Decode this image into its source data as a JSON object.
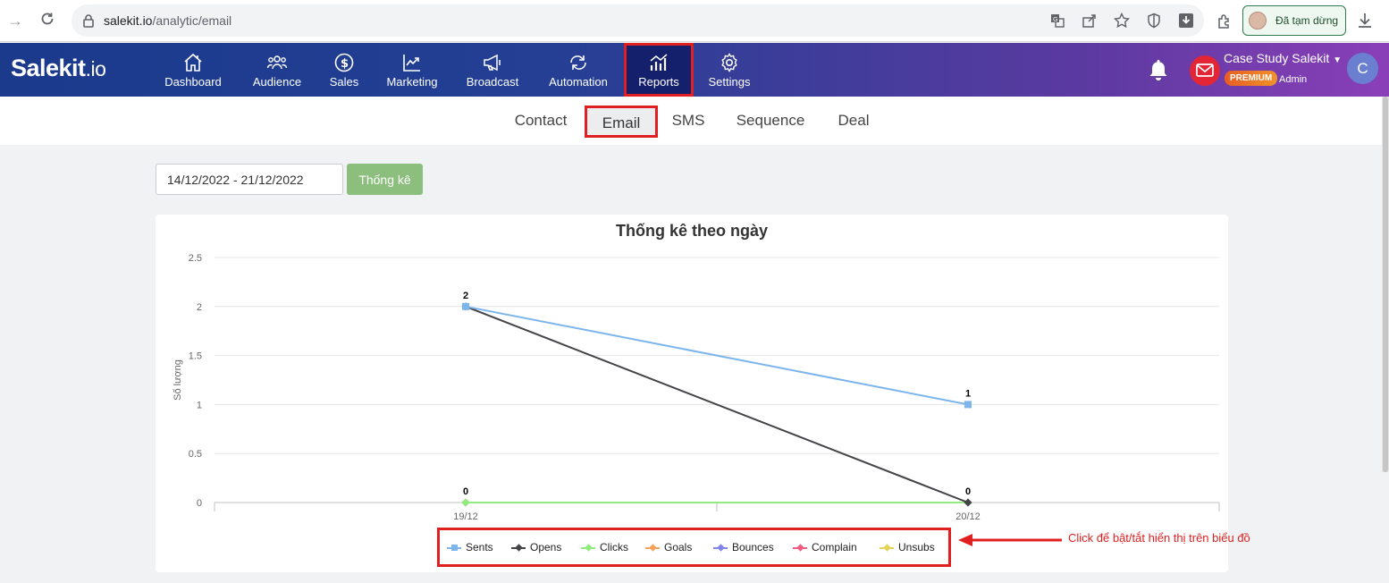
{
  "browser": {
    "url_host": "salekit.io",
    "url_path": "/analytic/email",
    "paused_label": "Đã tạm dừng"
  },
  "app": {
    "logo_main": "Salekit",
    "logo_suffix": ".io",
    "nav": [
      {
        "label": "Dashboard",
        "icon": "home-icon"
      },
      {
        "label": "Audience",
        "icon": "users-icon"
      },
      {
        "label": "Sales",
        "icon": "dollar-icon"
      },
      {
        "label": "Marketing",
        "icon": "trend-icon"
      },
      {
        "label": "Broadcast",
        "icon": "megaphone-icon"
      },
      {
        "label": "Automation",
        "icon": "cycle-icon"
      },
      {
        "label": "Reports",
        "icon": "bar-chart-icon"
      },
      {
        "label": "Settings",
        "icon": "gear-icon"
      }
    ],
    "active_nav": "Reports",
    "account_name": "Case Study Salekit",
    "badge": "PREMIUM",
    "role": "Admin",
    "avatar_letter": "C"
  },
  "tabs": [
    {
      "label": "Contact"
    },
    {
      "label": "Email"
    },
    {
      "label": "SMS"
    },
    {
      "label": "Sequence"
    },
    {
      "label": "Deal"
    }
  ],
  "active_tab": "Email",
  "filter": {
    "date_range": "14/12/2022 - 21/12/2022",
    "button_label": "Thống kê"
  },
  "annotation": "Click để bật/tắt hiển thị trên biểu đồ",
  "chart_data": {
    "type": "line",
    "title": "Thống kê theo ngày",
    "ylabel": "Số lượng",
    "xlabel": "",
    "categories": [
      "19/12",
      "20/12"
    ],
    "ylim": [
      0,
      2.5
    ],
    "yticks": [
      "0",
      "0.5",
      "1",
      "1.5",
      "2",
      "2.5"
    ],
    "grid": true,
    "legend_position": "bottom",
    "series": [
      {
        "name": "Sents",
        "values": [
          2,
          1
        ],
        "color": "#7cb5ec",
        "marker": "square"
      },
      {
        "name": "Opens",
        "values": [
          2,
          0
        ],
        "color": "#434348",
        "marker": "diamond"
      },
      {
        "name": "Clicks",
        "values": [
          0,
          0
        ],
        "color": "#90ed7d",
        "marker": "diamond"
      },
      {
        "name": "Goals",
        "values": [
          0,
          0
        ],
        "color": "#f7a35c",
        "marker": "diamond"
      },
      {
        "name": "Bounces",
        "values": [
          0,
          0
        ],
        "color": "#8085e9",
        "marker": "diamond"
      },
      {
        "name": "Complain",
        "values": [
          0,
          0
        ],
        "color": "#f15c80",
        "marker": "diamond"
      },
      {
        "name": "Unsubs",
        "values": [
          0,
          0
        ],
        "color": "#e4d354",
        "marker": "diamond"
      }
    ],
    "data_labels": [
      {
        "category": "19/12",
        "text": "2"
      },
      {
        "category": "19/12",
        "text": "0"
      },
      {
        "category": "20/12",
        "text": "1"
      },
      {
        "category": "20/12",
        "text": "0"
      }
    ]
  }
}
